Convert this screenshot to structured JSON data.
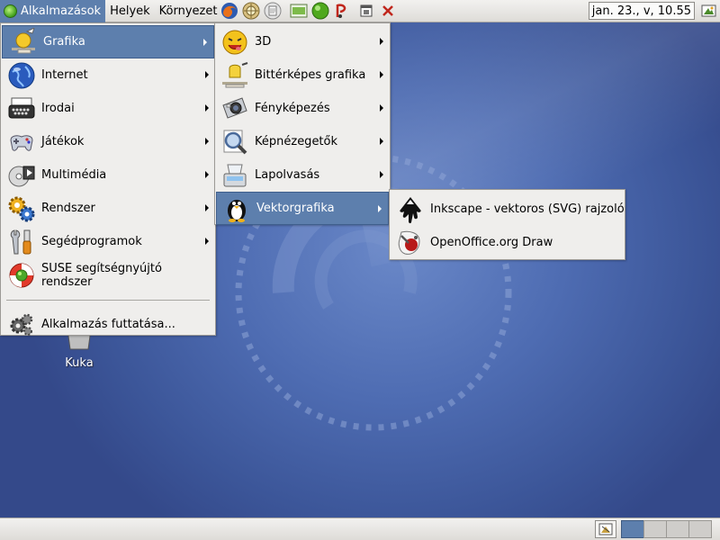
{
  "top_panel": {
    "applications_label": "Alkalmazások",
    "places_label": "Helyek",
    "desktop_label": "Környezet",
    "launchers": [
      "firefox-icon",
      "evolution-icon",
      "document-icon",
      "terminal-icon",
      "green-orb-icon",
      "media-icon",
      "window-icon",
      "close-x-icon"
    ],
    "clock": "jan. 23., v, 10.55"
  },
  "main_menu": {
    "items": [
      {
        "label": "Grafika",
        "icon": "graphics-icon",
        "submenu": true
      },
      {
        "label": "Internet",
        "icon": "globe-icon",
        "submenu": true
      },
      {
        "label": "Irodai",
        "icon": "typewriter-icon",
        "submenu": true
      },
      {
        "label": "Játékok",
        "icon": "gamepad-icon",
        "submenu": true
      },
      {
        "label": "Multimédia",
        "icon": "multimedia-icon",
        "submenu": true
      },
      {
        "label": "Rendszer",
        "icon": "gears-icon",
        "submenu": true
      },
      {
        "label": "Segédprogramok",
        "icon": "tools-icon",
        "submenu": true
      },
      {
        "label": "SUSE segítségnyújtó rendszer",
        "icon": "lifebuoy-icon",
        "submenu": false
      },
      {
        "label": "Alkalmazás futtatása...",
        "icon": "run-gears-icon",
        "submenu": false
      }
    ]
  },
  "grafika_menu": {
    "items": [
      {
        "label": "3D",
        "icon": "face-3d-icon"
      },
      {
        "label": "Bittérképes grafika",
        "icon": "paint-icon"
      },
      {
        "label": "Fényképezés",
        "icon": "camera-icon"
      },
      {
        "label": "Képnézegetők",
        "icon": "magnifier-icon"
      },
      {
        "label": "Lapolvasás",
        "icon": "scanner-icon"
      },
      {
        "label": "Vektorgrafika",
        "icon": "penguin-icon"
      }
    ]
  },
  "vektor_menu": {
    "items": [
      {
        "label": "Inkscape - vektoros (SVG) rajzoló",
        "icon": "inkscape-icon"
      },
      {
        "label": "OpenOffice.org Draw",
        "icon": "oodraw-icon"
      }
    ]
  },
  "desktop": {
    "trash_label": "Kuka"
  },
  "colors": {
    "selection": "#5d7fad",
    "menu_bg": "#efeeec",
    "desktop": "#4e6cb2"
  }
}
